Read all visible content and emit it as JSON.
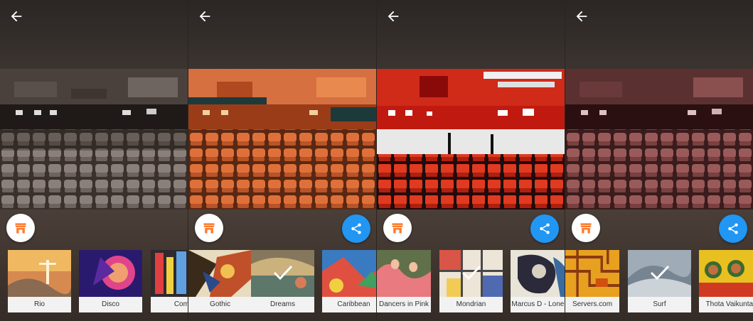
{
  "colors": {
    "accent": "#2196f3",
    "shop_orange": "#ff7a2a",
    "label_bg": "#f2f2f2"
  },
  "panels": [
    {
      "filter": "original",
      "shop_icon": "store-icon",
      "share_icon": null,
      "styles": [
        {
          "label": "Rio",
          "selected": false
        },
        {
          "label": "Disco",
          "selected": false
        },
        {
          "label": "Comi",
          "selected": false
        }
      ]
    },
    {
      "filter": "dreams",
      "shop_icon": "store-icon",
      "share_icon": "share-icon",
      "styles": [
        {
          "label": "Gothic",
          "selected": false
        },
        {
          "label": "Dreams",
          "selected": true
        },
        {
          "label": "Caribbean",
          "selected": false
        }
      ]
    },
    {
      "filter": "mondrian",
      "shop_icon": "store-icon",
      "share_icon": "share-icon",
      "styles": [
        {
          "label": "Dancers in Pink",
          "selected": false
        },
        {
          "label": "Mondrian",
          "selected": true
        },
        {
          "label": "Marcus D - Lone W",
          "selected": false
        }
      ]
    },
    {
      "filter": "surf",
      "shop_icon": "store-icon",
      "share_icon": "share-icon",
      "styles": [
        {
          "label": "Servers.com",
          "selected": false
        },
        {
          "label": "Surf",
          "selected": true
        },
        {
          "label": "Thota Vaikuntar",
          "selected": false
        }
      ]
    }
  ]
}
